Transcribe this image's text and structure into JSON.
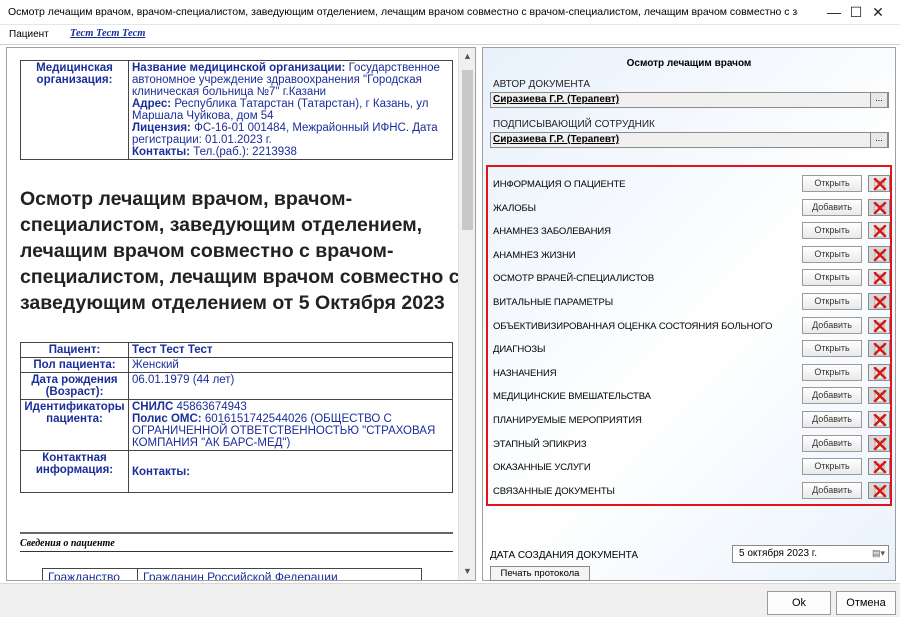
{
  "window": {
    "title": "Осмотр лечащим врачом, врачом-специалистом, заведующим отделением, лечащим врачом совместно с врачом-специалистом, лечащим врачом совместно с заведую...",
    "minimize": "—",
    "maximize": "☐",
    "close": "✕"
  },
  "patient_bar": {
    "label": "Пациент",
    "value": "Тест Тест Тест"
  },
  "document": {
    "org_label": "Медицинская организация:",
    "org_name_label": "Название медицинской организации:",
    "org_name": "Государственное автономное учреждение здравоохранения \"Городская клиническая больница №7\" г.Казани",
    "address_label": "Адрес:",
    "address": "Республика Татарстан (Татарстан), г Казань, ул Маршала Чуйкова, дом 54",
    "license_label": "Лицензия:",
    "license": "ФС-16-01 001484, Межрайонный ИФНС. Дата регистрации: 01.01.2023 г.",
    "contacts_label": "Контакты:",
    "contacts": "Тел.(раб.): 2213938",
    "title": "Осмотр лечащим врачом, врачом-специалистом, заведующим отделением, лечащим врачом совместно с врачом-специалистом, лечащим врачом совместно с заведующим отделением от 5 Октября 2023",
    "patient": {
      "name_label": "Пациент:",
      "name": "Тест Тест Тест",
      "sex_label": "Пол пациента:",
      "sex": "Женский",
      "dob_label": "Дата рождения (Возраст):",
      "dob": "06.01.1979 (44 лет)",
      "ids_label": "Идентификаторы пациента:",
      "snils_label": "СНИЛС",
      "snils": "45863674943",
      "oms_label": "Полис ОМС:",
      "oms": "6016151742544026 (ОБЩЕСТВО С ОГРАНИЧЕННОЙ ОТВЕТСТВЕННОСТЬЮ \"СТРАХОВАЯ КОМПАНИЯ \"АК БАРС-МЕД\")",
      "contact_label": "Контактная информация:",
      "contact_value": "Контакты:"
    },
    "section_heading": "Сведения о пациенте",
    "citizenship_label": "Гражданство",
    "citizenship": "Гражданин Российской Федерации"
  },
  "panel": {
    "title": "Осмотр лечащим врачом",
    "author_label": "АВТОР ДОКУМЕНТА",
    "author": "Сиразиева Г.Р. (Терапевт)",
    "signer_label": "ПОДПИСЫВАЮЩИЙ СОТРУДНИК",
    "signer": "Сиразиева Г.Р. (Терапевт)",
    "ellipsis": "...",
    "sections": [
      {
        "label": "ИНФОРМАЦИЯ О ПАЦИЕНТЕ",
        "action": "Открыть"
      },
      {
        "label": "ЖАЛОБЫ",
        "action": "Добавить"
      },
      {
        "label": "АНАМНЕЗ ЗАБОЛЕВАНИЯ",
        "action": "Открыть"
      },
      {
        "label": "АНАМНЕЗ ЖИЗНИ",
        "action": "Открыть"
      },
      {
        "label": "ОСМОТР ВРАЧЕЙ-СПЕЦИАЛИСТОВ",
        "action": "Открыть"
      },
      {
        "label": "ВИТАЛЬНЫЕ ПАРАМЕТРЫ",
        "action": "Открыть"
      },
      {
        "label": "ОБЪЕКТИВИЗИРОВАННАЯ ОЦЕНКА СОСТОЯНИЯ БОЛЬНОГО",
        "action": "Добавить"
      },
      {
        "label": "ДИАГНОЗЫ",
        "action": "Открыть"
      },
      {
        "label": "НАЗНАЧЕНИЯ",
        "action": "Открыть"
      },
      {
        "label": "МЕДИЦИНСКИЕ ВМЕШАТЕЛЬСТВА",
        "action": "Добавить"
      },
      {
        "label": "ПЛАНИРУЕМЫЕ МЕРОПРИЯТИЯ",
        "action": "Добавить"
      },
      {
        "label": "ЭТАПНЫЙ ЭПИКРИЗ",
        "action": "Добавить"
      },
      {
        "label": "ОКАЗАННЫЕ УСЛУГИ",
        "action": "Открыть"
      },
      {
        "label": "СВЯЗАННЫЕ ДОКУМЕНТЫ",
        "action": "Добавить"
      }
    ],
    "date_label": "ДАТА СОЗДАНИЯ ДОКУМЕНТА",
    "date_value": "5 октября  2023 г.",
    "print_label": "Печать протокола",
    "highlight_color": "#e0141c"
  },
  "footer": {
    "ok": "Ok",
    "cancel": "Отмена"
  }
}
